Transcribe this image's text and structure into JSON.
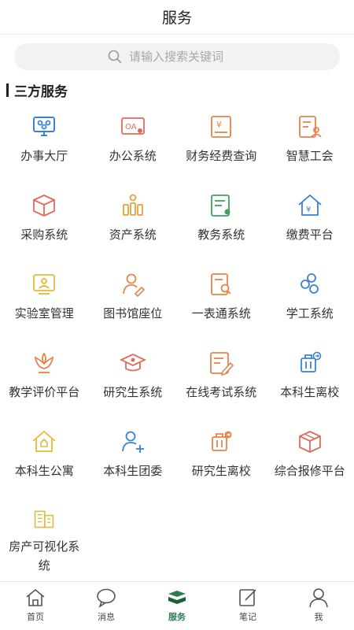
{
  "header": {
    "title": "服务"
  },
  "search": {
    "placeholder": "请输入搜索关键词"
  },
  "section": {
    "title": "三方服务"
  },
  "services": [
    {
      "label": "办事大厅",
      "icon": "office-hall-icon",
      "color": "#3b82d4"
    },
    {
      "label": "办公系统",
      "icon": "oa-icon",
      "color": "#e06b5a"
    },
    {
      "label": "财务经费查询",
      "icon": "finance-icon",
      "color": "#e8834a"
    },
    {
      "label": "智慧工会",
      "icon": "union-icon",
      "color": "#e8834a"
    },
    {
      "label": "采购系统",
      "icon": "purchase-box-icon",
      "color": "#e06b5a"
    },
    {
      "label": "资产系统",
      "icon": "assets-icon",
      "color": "#e8a03a"
    },
    {
      "label": "教务系统",
      "icon": "academic-doc-icon",
      "color": "#3da35d"
    },
    {
      "label": "缴费平台",
      "icon": "payment-house-icon",
      "color": "#3b82d4"
    },
    {
      "label": "实验室管理",
      "icon": "lab-icon",
      "color": "#e8b83a"
    },
    {
      "label": "图书馆座位",
      "icon": "library-seat-icon",
      "color": "#e8834a"
    },
    {
      "label": "一表通系统",
      "icon": "form-search-icon",
      "color": "#e8834a"
    },
    {
      "label": "学工系统",
      "icon": "students-icon",
      "color": "#3b82d4"
    },
    {
      "label": "教学评价平台",
      "icon": "lotus-icon",
      "color": "#e8834a"
    },
    {
      "label": "研究生系统",
      "icon": "graduate-cap-icon",
      "color": "#e06b5a"
    },
    {
      "label": "在线考试系统",
      "icon": "exam-edit-icon",
      "color": "#e8834a"
    },
    {
      "label": "本科生离校",
      "icon": "luggage-icon",
      "color": "#3b82d4"
    },
    {
      "label": "本科生公寓",
      "icon": "dorm-house-icon",
      "color": "#e8b83a"
    },
    {
      "label": "本科生团委",
      "icon": "add-user-icon",
      "color": "#3b82d4"
    },
    {
      "label": "研究生离校",
      "icon": "luggage-icon",
      "color": "#e8834a"
    },
    {
      "label": "综合报修平台",
      "icon": "repair-box-icon",
      "color": "#e06b5a"
    },
    {
      "label": "房产可视化系统",
      "icon": "building-icon",
      "color": "#e8b83a"
    }
  ],
  "tabbar": [
    {
      "label": "首页",
      "icon": "home-icon",
      "active": false
    },
    {
      "label": "消息",
      "icon": "message-icon",
      "active": false
    },
    {
      "label": "服务",
      "icon": "service-icon",
      "active": true
    },
    {
      "label": "笔记",
      "icon": "note-icon",
      "active": false
    },
    {
      "label": "我",
      "icon": "profile-icon",
      "active": false
    }
  ],
  "colors": {
    "accent": "#2e7d4f"
  }
}
